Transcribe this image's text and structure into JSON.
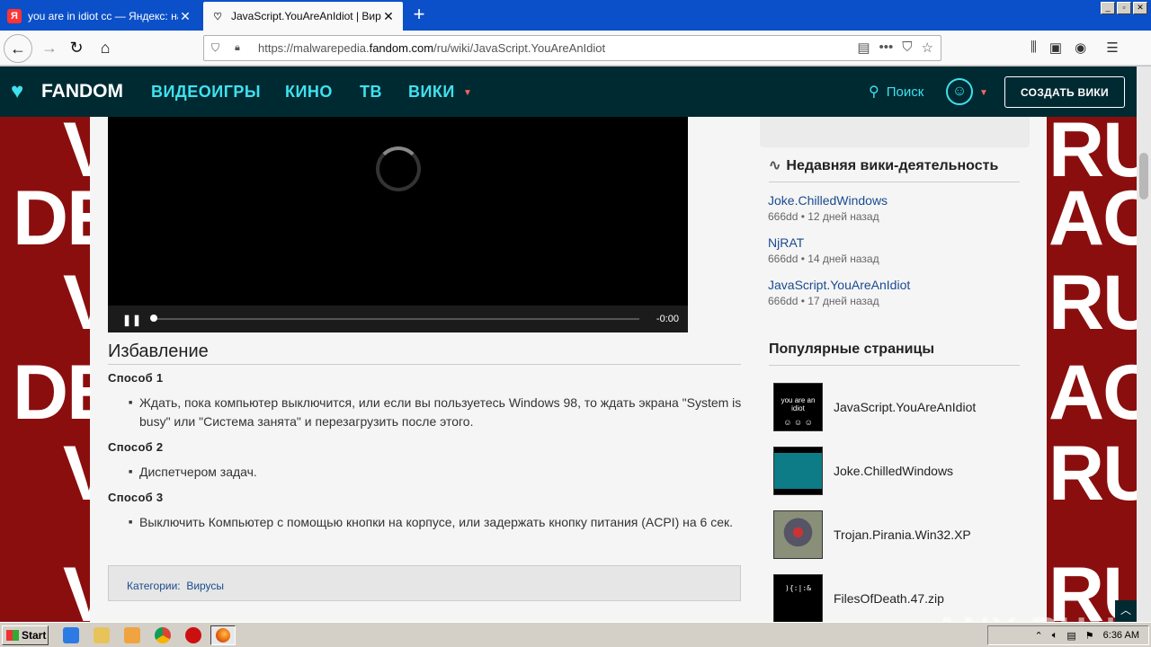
{
  "browser": {
    "tabs": [
      {
        "title": "you are in idiot cc — Яндекс: наш",
        "favicon": "yandex-icon"
      },
      {
        "title": "JavaScript.YouAreAnIdiot | Вирус",
        "favicon": "fandom-icon"
      }
    ],
    "url_prefix": "https://malwarepedia.",
    "url_domain": "fandom.com",
    "url_path": "/ru/wiki/JavaScript.YouAreAnIdiot"
  },
  "fandom": {
    "logo_text": "FANDOM",
    "nav": [
      "ВИДЕОИГРЫ",
      "КИНО",
      "ТВ",
      "ВИКИ"
    ],
    "search_label": "Поиск",
    "create_label": "СОЗДАТЬ ВИКИ",
    "accent": "#3fe1ee"
  },
  "video": {
    "time": "-0:00"
  },
  "article": {
    "section_title": "Избавление",
    "methods": [
      {
        "title": "Способ 1",
        "text": "Ждать, пока компьютер выключится, или если вы пользуетесь Windows 98, то ждать экрана \"System is busy\" или \"Система занята\" и перезагрузить после этого."
      },
      {
        "title": "Способ 2",
        "text": "Диспетчером задач."
      },
      {
        "title": "Способ 3",
        "text": "Выключить Компьютер с помощью кнопки на корпусе, или задержать кнопку питания (ACPI) на 6 сек."
      }
    ],
    "categories_label": "Категории:",
    "category": "Вирусы"
  },
  "rail": {
    "activity_title": "Недавняя вики-деятельность",
    "activity": [
      {
        "page": "Joke.ChilledWindows",
        "meta": "666dd • 12 дней назад"
      },
      {
        "page": "NjRAT",
        "meta": "666dd • 14 дней назад"
      },
      {
        "page": "JavaScript.YouAreAnIdiot",
        "meta": "666dd • 17 дней назад"
      }
    ],
    "popular_title": "Популярные страницы",
    "popular": [
      {
        "title": "JavaScript.YouAreAnIdiot",
        "thumb_text": "you are an idiot"
      },
      {
        "title": "Joke.ChilledWindows"
      },
      {
        "title": "Trojan.Pirania.Win32.XP"
      },
      {
        "title": "FilesOfDeath.47.zip"
      }
    ]
  },
  "background_words": [
    "DET",
    "V",
    "RUS",
    "ACTI"
  ],
  "taskbar": {
    "start_label": "Start",
    "clock": "6:36 AM"
  },
  "watermark": "ANY RUN"
}
